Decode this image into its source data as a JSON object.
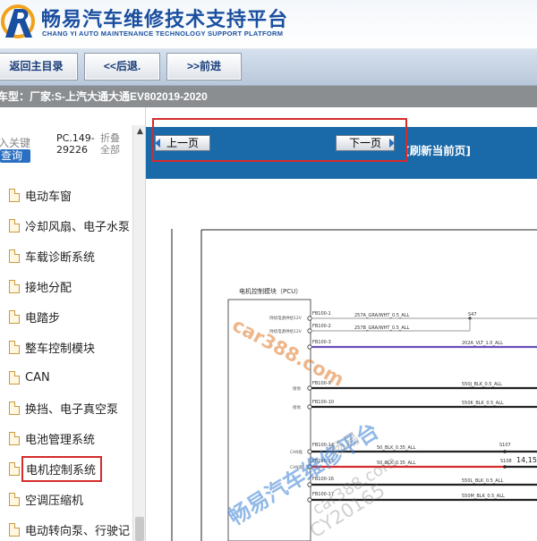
{
  "header": {
    "title": "畅易汽车维修技术支持平台",
    "subtitle": "CHANG YI AUTO MAINTENANCE TECHNOLOGY SUPPORT PLATFORM",
    "brand_color": "#1a4fa0"
  },
  "toolbar": {
    "home_label": "返回主目录",
    "back_label": "<<后退.",
    "forward_label": ">>前进"
  },
  "vehicle": {
    "label": "车型：",
    "value": "厂家:S-上汽大通大通EV802019-2020"
  },
  "sidebar": {
    "keyword_hint": "入关键",
    "query_label": "查询",
    "pc_code": [
      "PC.149-",
      "29226"
    ],
    "fold_all": [
      "折叠",
      "全部"
    ],
    "items": [
      {
        "label": "电动车窗",
        "icon": "document-icon"
      },
      {
        "label": "冷却风扇、电子水泵",
        "icon": "document-icon"
      },
      {
        "label": "车载诊断系统",
        "icon": "document-icon"
      },
      {
        "label": "接地分配",
        "icon": "document-icon"
      },
      {
        "label": "电踏步",
        "icon": "document-icon"
      },
      {
        "label": "整车控制模块",
        "icon": "document-icon"
      },
      {
        "label": "CAN",
        "icon": "document-icon"
      },
      {
        "label": "换挡、电子真空泵",
        "icon": "document-icon"
      },
      {
        "label": "电池管理系统",
        "icon": "document-icon"
      },
      {
        "label": "电机控制系统",
        "icon": "document-icon",
        "selected": true
      },
      {
        "label": "空调压缩机",
        "icon": "document-icon"
      },
      {
        "label": "电动转向泵、行驶记",
        "icon": "document-icon"
      }
    ]
  },
  "page_nav": {
    "prev_label": "上一页",
    "next_label": "下一页",
    "refresh_label": "[刷新当前页]",
    "bar_color": "#1a69a8"
  },
  "diagram": {
    "module_title": "电机控制模块（PCU）",
    "pins": [
      {
        "pin": "FB100-1",
        "note": "持续电源供给12V",
        "wire": "257A_GRA/WHT_0.5_ALL",
        "dest": "S47"
      },
      {
        "pin": "FB100-2",
        "note": "持续电源供给12V",
        "wire": "257B_GRA/WHT_0.5_ALL",
        "dest": ""
      },
      {
        "pin": "FB100-3",
        "note": "",
        "wire": "202A_VLT_1.0_ALL",
        "dest": ""
      },
      {
        "pin": "FB100-9",
        "note": "接地",
        "wire": "550J_BLK_0.5_ALL",
        "dest": ""
      },
      {
        "pin": "FB100-10",
        "note": "接地",
        "wire": "550K_BLK_0.5_ALL",
        "dest": ""
      },
      {
        "pin": "FB100-14",
        "note": "CAN低",
        "wire": "50_BLK_0.35_ALL",
        "dest": "S107"
      },
      {
        "pin": "FB100-15",
        "note": "CAN高",
        "wire": "50_BLK_0.35_ALL",
        "dest": "S108"
      },
      {
        "pin": "FB100-16",
        "note": "",
        "wire": "550L_BLK_0.5_ALL",
        "dest": ""
      },
      {
        "pin": "FB100-17",
        "note": "",
        "wire": "550M_BLK_0.5_ALL",
        "dest": ""
      }
    ],
    "side_note": "14,15",
    "watermark_site": "car388.com",
    "watermark_platform": "畅易汽车维修平台",
    "watermark_small": "畅易",
    "watermark_site2": "car388.com",
    "watermark_id": "CY20165"
  }
}
